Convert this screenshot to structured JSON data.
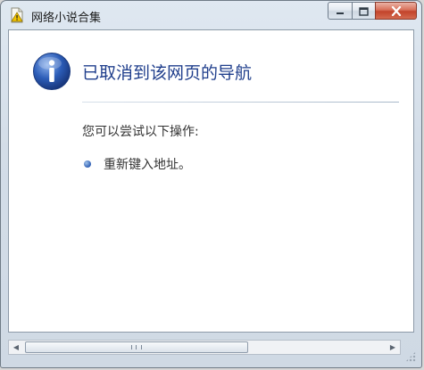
{
  "window": {
    "title": "网络小说合集",
    "icons": {
      "app": "page-warning-icon",
      "minimize": "minimize-icon",
      "maximize": "maximize-icon",
      "close": "close-icon"
    }
  },
  "page": {
    "icon": "info-icon",
    "headline": "已取消到该网页的导航",
    "subtitle": "您可以尝试以下操作:",
    "suggestions": [
      "重新键入地址。"
    ]
  },
  "colors": {
    "headline": "#1f3e8c",
    "close_button": "#c2432a",
    "info_icon": "#2c5db8"
  }
}
